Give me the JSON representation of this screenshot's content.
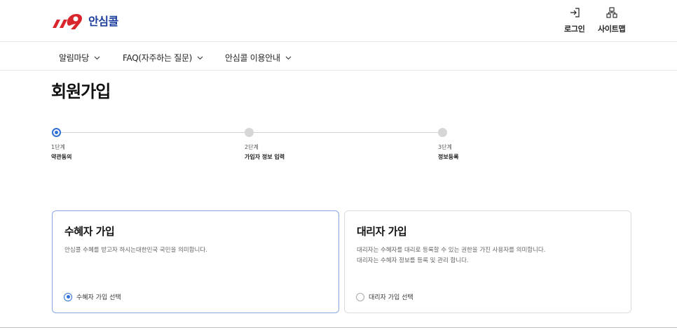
{
  "logo": {
    "text": "안심콜",
    "mark_colors": [
      "#d8262c",
      "#1a3d9c"
    ]
  },
  "util": {
    "login": {
      "label": "로그인",
      "icon": "login-icon"
    },
    "sitemap": {
      "label": "사이트맵",
      "icon": "sitemap-icon"
    }
  },
  "gnb": {
    "items": [
      {
        "label": "알림마당"
      },
      {
        "label": "FAQ(자주하는 질문)"
      },
      {
        "label": "안심콜 이용안내"
      }
    ]
  },
  "page": {
    "title": "회원가입"
  },
  "steps": [
    {
      "num": "1단계",
      "name": "약관동의",
      "active": true
    },
    {
      "num": "2단계",
      "name": "가입자 정보 입력",
      "active": false
    },
    {
      "num": "3단계",
      "name": "정보등록",
      "active": false
    }
  ],
  "cards": [
    {
      "title": "수혜자 가입",
      "desc": [
        "안심콜 수혜를 받고자 하시는대한민국 국민을 의미합니다."
      ],
      "radio_label": "수혜자 가입 선택",
      "selected": true
    },
    {
      "title": "대리자 가입",
      "desc": [
        "대리자는 수혜자를 대리로 등록할 수 있는 권한을 가진 사용자를 의미합니다.",
        "대리자는 수혜자 정보를 등록 및 관리 합니다."
      ],
      "radio_label": "대리자 가입 선택",
      "selected": false
    }
  ],
  "colors": {
    "accent": "#2f6fd6",
    "logo_red": "#d8262c",
    "logo_blue": "#1a3d9c"
  }
}
